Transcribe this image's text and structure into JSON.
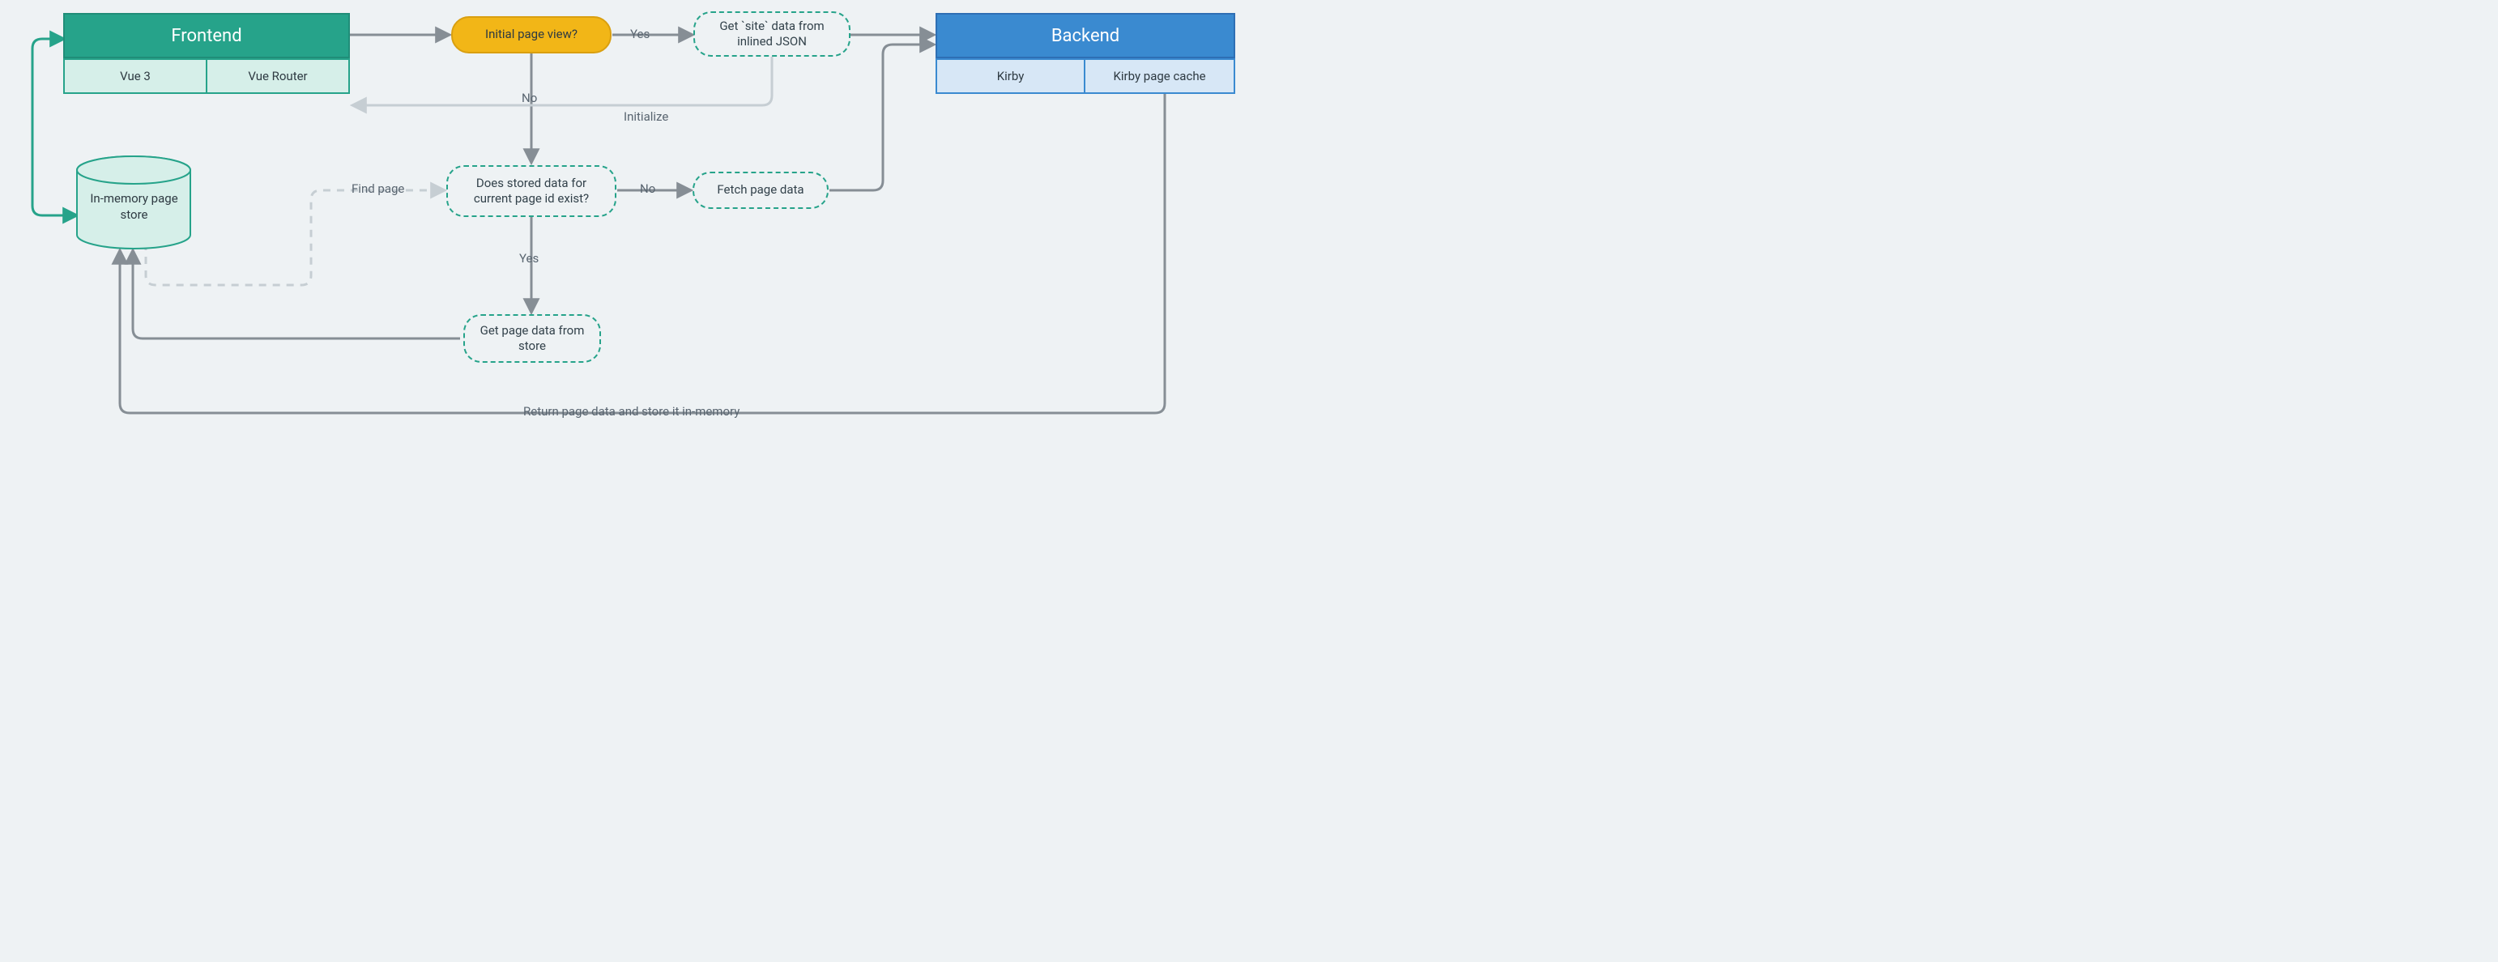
{
  "frontend": {
    "title": "Frontend",
    "subs": {
      "vue": "Vue 3",
      "router": "Vue Router"
    }
  },
  "backend": {
    "title": "Backend",
    "subs": {
      "kirby": "Kirby",
      "cache": "Kirby page cache"
    }
  },
  "nodes": {
    "initial": "Initial page view?",
    "getSite": "Get `site` data from inlined JSON",
    "storedExists": "Does stored data for current page id exist?",
    "fetch": "Fetch page data",
    "getFromStore": "Get page data from store",
    "store": "In-memory page store"
  },
  "edges": {
    "yes1": "Yes",
    "no1": "No",
    "initialize": "Initialize",
    "findPage": "Find page",
    "no2": "No",
    "yes2": "Yes",
    "returnStore": "Return page data and store it in-memory"
  }
}
